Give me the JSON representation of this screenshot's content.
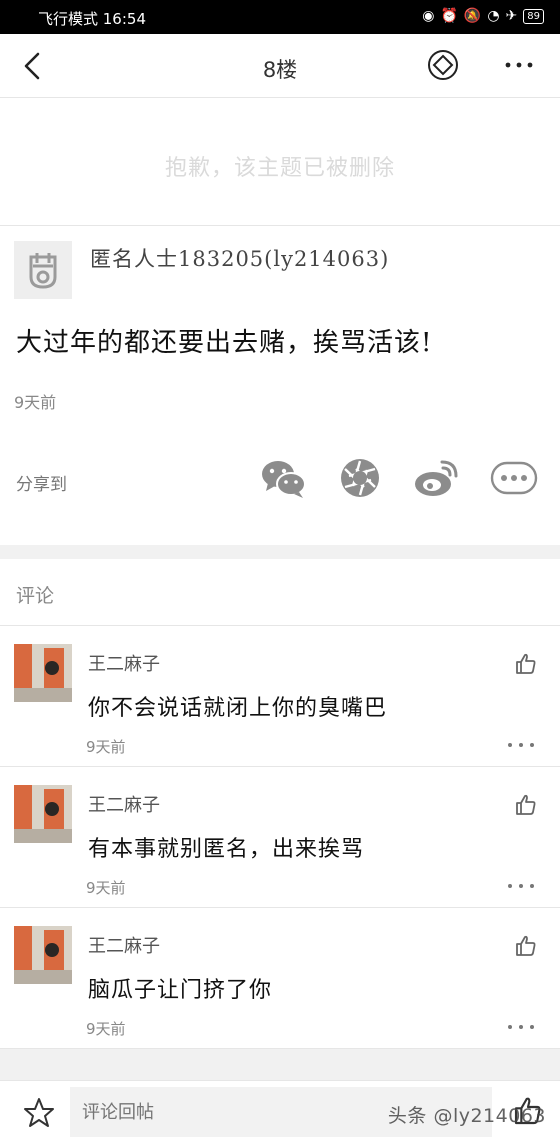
{
  "status_bar": {
    "left_text": "飞行模式 16:54",
    "battery": "89"
  },
  "header": {
    "title": "8楼"
  },
  "notice": {
    "deleted_text": "抱歉，该主题已被删除"
  },
  "post": {
    "author": "匿名人士183205(ly214063)",
    "body": "大过年的都还要出去赌，挨骂活该!",
    "time": "9天前"
  },
  "share": {
    "label": "分享到",
    "targets": [
      "wechat-icon",
      "moments-icon",
      "weibo-icon",
      "more-icon"
    ]
  },
  "comments_section": {
    "title": "评论",
    "items": [
      {
        "name": "王二麻子",
        "text": "你不会说话就闭上你的臭嘴巴",
        "time": "9天前"
      },
      {
        "name": "王二麻子",
        "text": "有本事就别匿名，出来挨骂",
        "time": "9天前"
      },
      {
        "name": "王二麻子",
        "text": "脑瓜子让门挤了你",
        "time": "9天前"
      }
    ]
  },
  "bottom_bar": {
    "reply_placeholder": "评论回帖",
    "watermark": "头条 @ly214063"
  },
  "colors": {
    "accent_orange": "#d8693f",
    "wechat_gray": "#8c8c8c",
    "background_gap": "#f1f1f1"
  }
}
